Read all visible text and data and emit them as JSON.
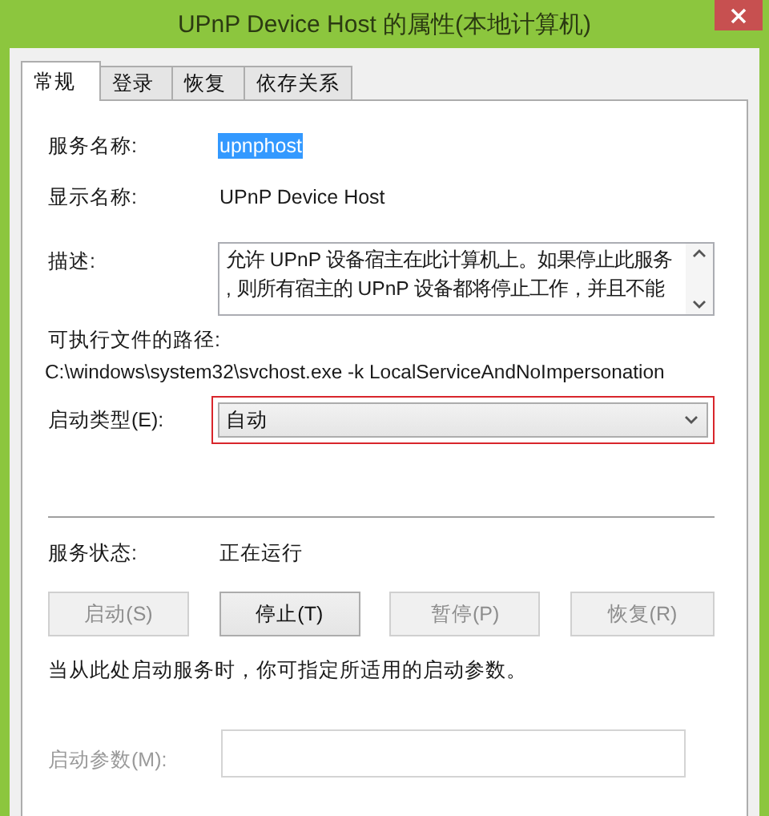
{
  "window": {
    "title": "UPnP Device Host 的属性(本地计算机)"
  },
  "tabs": [
    {
      "label": "常规",
      "selected": true
    },
    {
      "label": "登录",
      "selected": false
    },
    {
      "label": "恢复",
      "selected": false
    },
    {
      "label": "依存关系",
      "selected": false
    }
  ],
  "service_name": {
    "label": "服务名称:",
    "value": "upnphost",
    "highlighted": true
  },
  "display_name": {
    "label": "显示名称:",
    "value": "UPnP Device Host"
  },
  "description": {
    "label": "描述:",
    "lines": [
      "允许 UPnP 设备宿主在此计算机上。如果停止此服务",
      ", 则所有宿主的 UPnP 设备都将停止工作，并且不能"
    ]
  },
  "path": {
    "label": "可执行文件的路径:",
    "value": "C:\\windows\\system32\\svchost.exe -k LocalServiceAndNoImpersonation"
  },
  "startup_type": {
    "label": "启动类型(E):",
    "value": "自动",
    "highlighted": true
  },
  "status": {
    "label": "服务状态:",
    "value": "正在运行"
  },
  "buttons": [
    {
      "label": "启动(S)",
      "disabled": true
    },
    {
      "label": "停止(T)",
      "disabled": false
    },
    {
      "label": "暂停(P)",
      "disabled": true
    },
    {
      "label": "恢复(R)",
      "disabled": true
    }
  ],
  "hint": "当从此处启动服务时，你可指定所适用的启动参数。",
  "start_params": {
    "label": "启动参数(M):",
    "disabled": true
  }
}
